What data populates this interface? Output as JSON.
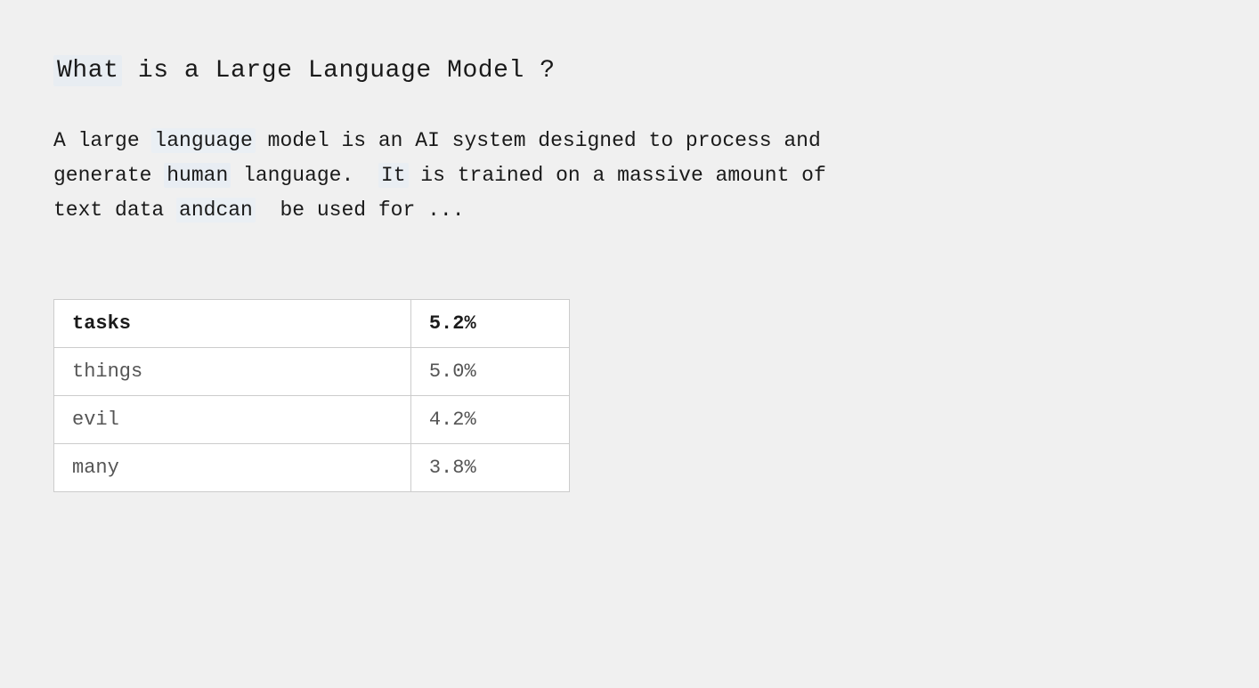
{
  "heading": {
    "text": "What is a Large Language Model ?",
    "words": [
      "What",
      "is",
      "a",
      "Large",
      "Language",
      "Model",
      "?"
    ]
  },
  "body": {
    "text": "A large language model is an AI system designed to process and generate human language.  It is trained on a massive amount of text data andcan  be used for ..."
  },
  "table": {
    "rows": [
      {
        "label": "tasks",
        "value": "5.2%",
        "bold": true
      },
      {
        "label": "things",
        "value": "5.0%",
        "bold": false
      },
      {
        "label": "evil",
        "value": "4.2%",
        "bold": false
      },
      {
        "label": "many",
        "value": "3.8%",
        "bold": false
      }
    ]
  }
}
